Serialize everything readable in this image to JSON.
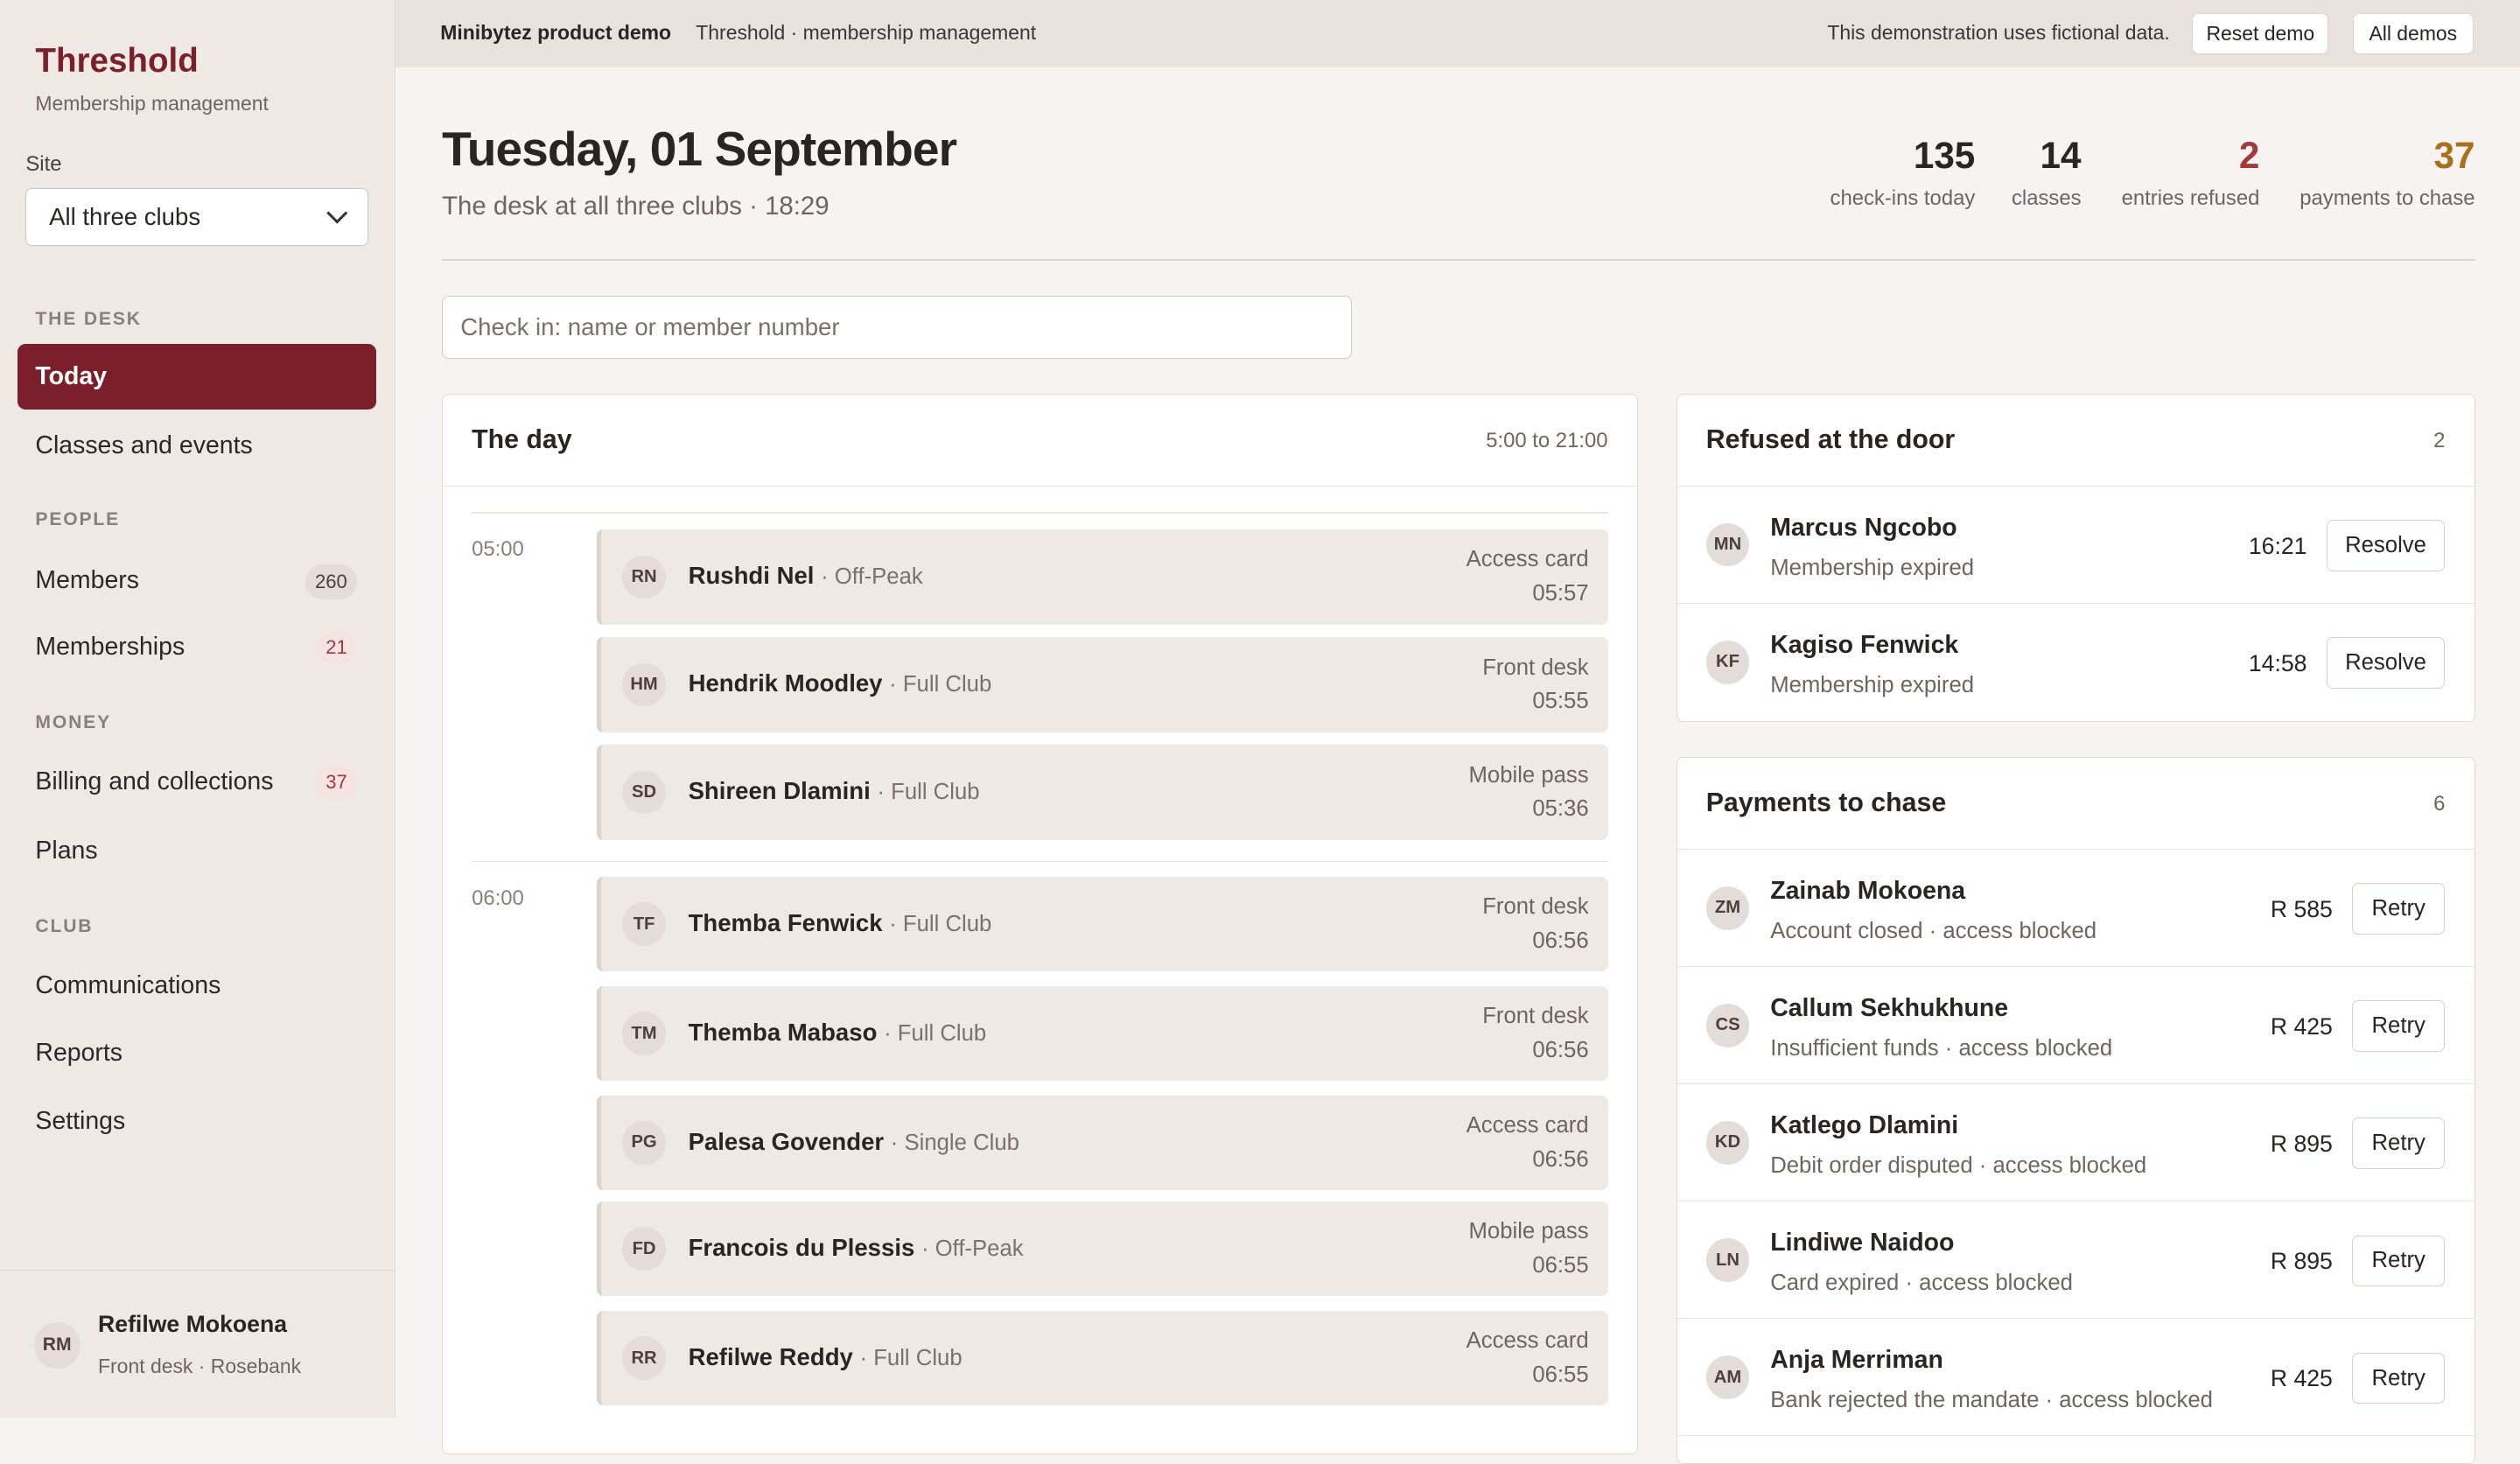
{
  "sidebar": {
    "brand": "Threshold",
    "brand_sub": "Membership management",
    "site_label": "Site",
    "site_value": "All three clubs",
    "sections": {
      "desk": "THE DESK",
      "people": "PEOPLE",
      "money": "MONEY",
      "club": "CLUB"
    },
    "items": {
      "today": "Today",
      "classes": "Classes and events",
      "members": "Members",
      "members_count": "260",
      "memberships": "Memberships",
      "memberships_count": "21",
      "billing": "Billing and collections",
      "billing_count": "37",
      "plans": "Plans",
      "communications": "Communications",
      "reports": "Reports",
      "settings": "Settings"
    },
    "user": {
      "initials": "RM",
      "name": "Refilwe Mokoena",
      "role": "Front desk · Rosebank"
    }
  },
  "topbar": {
    "brand": "Minibytez product demo",
    "app": "Threshold · membership management",
    "note": "This demonstration uses fictional data.",
    "reset": "Reset demo",
    "all": "All demos"
  },
  "header": {
    "date": "Tuesday, 01 September",
    "subtitle": "The desk at all three clubs · 18:29",
    "stats": [
      {
        "value": "135",
        "label": "check-ins today"
      },
      {
        "value": "14",
        "label": "classes"
      },
      {
        "value": "2",
        "label": "entries refused"
      },
      {
        "value": "37",
        "label": "payments to chase"
      }
    ]
  },
  "checkin": {
    "placeholder": "Check in: name or member number"
  },
  "colors": {
    "brand": "#7b1f2b",
    "refused": "#a23a3a",
    "chase": "#a8701c"
  },
  "day": {
    "title": "The day",
    "range": "5:00 to 21:00",
    "hours": [
      {
        "label": "05:00",
        "visits": [
          {
            "initials": "RN",
            "name": "Rushdi Nel",
            "plan": "· Off-Peak",
            "source": "Access card",
            "time": "05:57"
          },
          {
            "initials": "HM",
            "name": "Hendrik Moodley",
            "plan": "· Full Club",
            "source": "Front desk",
            "time": "05:55"
          },
          {
            "initials": "SD",
            "name": "Shireen Dlamini",
            "plan": "· Full Club",
            "source": "Mobile pass",
            "time": "05:36"
          }
        ]
      },
      {
        "label": "06:00",
        "visits": [
          {
            "initials": "TF",
            "name": "Themba Fenwick",
            "plan": "· Full Club",
            "source": "Front desk",
            "time": "06:56"
          },
          {
            "initials": "TM",
            "name": "Themba Mabaso",
            "plan": "· Full Club",
            "source": "Front desk",
            "time": "06:56"
          },
          {
            "initials": "PG",
            "name": "Palesa Govender",
            "plan": "· Single Club",
            "source": "Access card",
            "time": "06:56"
          },
          {
            "initials": "FD",
            "name": "Francois du Plessis",
            "plan": "· Off-Peak",
            "source": "Mobile pass",
            "time": "06:55"
          },
          {
            "initials": "RR",
            "name": "Refilwe Reddy",
            "plan": "· Full Club",
            "source": "Access card",
            "time": "06:55"
          }
        ]
      }
    ]
  },
  "refused": {
    "title": "Refused at the door",
    "count": "2",
    "rows": [
      {
        "initials": "MN",
        "name": "Marcus Ngcobo",
        "desc": "Membership expired",
        "time": "16:21",
        "action": "Resolve"
      },
      {
        "initials": "KF",
        "name": "Kagiso Fenwick",
        "desc": "Membership expired",
        "time": "14:58",
        "action": "Resolve"
      }
    ]
  },
  "payments": {
    "title": "Payments to chase",
    "count": "6",
    "rows": [
      {
        "initials": "ZM",
        "name": "Zainab Mokoena",
        "desc": "Account closed · access blocked",
        "amount": "R 585",
        "action": "Retry"
      },
      {
        "initials": "CS",
        "name": "Callum Sekhukhune",
        "desc": "Insufficient funds · access blocked",
        "amount": "R 425",
        "action": "Retry"
      },
      {
        "initials": "KD",
        "name": "Katlego Dlamini",
        "desc": "Debit order disputed · access blocked",
        "amount": "R 895",
        "action": "Retry"
      },
      {
        "initials": "LN",
        "name": "Lindiwe Naidoo",
        "desc": "Card expired · access blocked",
        "amount": "R 895",
        "action": "Retry"
      },
      {
        "initials": "AM",
        "name": "Anja Merriman",
        "desc": "Bank rejected the mandate · access blocked",
        "amount": "R 425",
        "action": "Retry"
      }
    ]
  }
}
